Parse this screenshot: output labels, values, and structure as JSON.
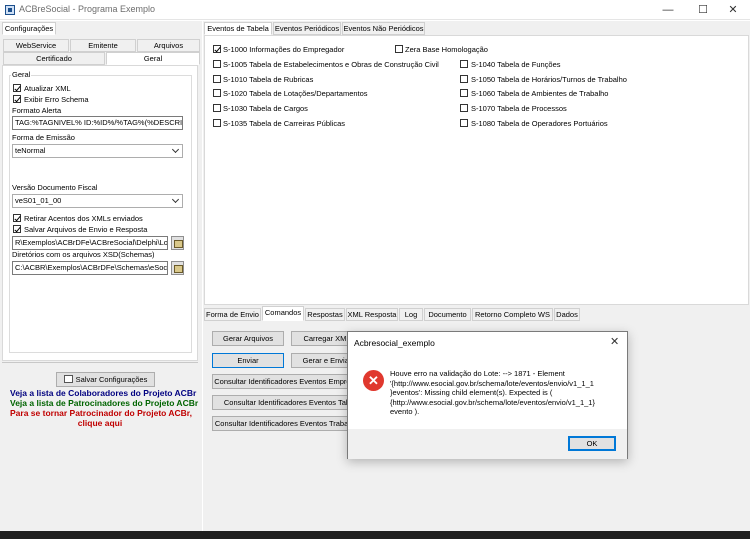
{
  "window": {
    "title": "ACBreSocial - Programa Exemplo",
    "minimize_glyph": "—",
    "maximize_glyph": "☐",
    "close_glyph": "✕"
  },
  "left": {
    "header": "Configurações",
    "tabs_row1": [
      "WebService",
      "Emitente",
      "Arquivos"
    ],
    "tabs_row2": [
      "Certificado",
      "Geral"
    ],
    "active_tab": "Geral",
    "group_title": "Geral",
    "chk_atualizar": "Atualizar XML",
    "chk_exibir": "Exibir Erro Schema",
    "lbl_formato": "Formato Alerta",
    "formato_value": "TAG:%TAGNIVEL% ID:%ID%/%TAG%(%DESCRI",
    "lbl_emissao": "Forma de Emissão",
    "emissao_value": "teNormal",
    "lbl_versao": "Versão Documento Fiscal",
    "versao_value": "veS01_01_00",
    "chk_retirar": "Retirar Acentos dos XMLs enviados",
    "chk_salvar": "Salvar Arquivos de Envio e Resposta",
    "logs_path": "R\\Exemplos\\ACBrDFe\\ACBreSocial\\Delphi\\Logs",
    "lbl_xsd": "Diretórios com os arquivos XSD(Schemas)",
    "xsd_path": "C:\\ACBR\\Exemplos\\ACBrDFe\\Schemas\\eSocial",
    "save_button": "Salvar Configurações",
    "link1": "Veja a lista de Colaboradores do Projeto ACBr",
    "link2": "Veja a lista de Patrocinadores do Projeto ACBr",
    "link3": "Para se tornar Patrocinador do Projeto ACBr,",
    "link4": "clique aqui"
  },
  "events": {
    "tabs": [
      "Eventos de Tabela",
      "Eventos Periódicos",
      "Eventos Não Periódicos"
    ],
    "col1": [
      "S-1000 Informações do Empregador",
      "S-1005 Tabela de Estabelecimentos e Obras de Construção Civil",
      "S-1010 Tabela de Rubricas",
      "S-1020 Tabela de Lotações/Departamentos",
      "S-1030 Tabela de Cargos",
      "S-1035 Tabela de Carreiras Públicas"
    ],
    "col2": [
      "Zera Base Homologação",
      "S-1040 Tabela de Funções",
      "S-1050 Tabela de Horários/Turnos de Trabalho",
      "S-1060 Tabela de Ambientes de Trabalho",
      "S-1070 Tabela de Processos",
      "S-1080 Tabela de Operadores Portuários"
    ]
  },
  "bottom": {
    "tabs": [
      "Forma de Envio",
      "Comandos",
      "Respostas",
      "XML Resposta",
      "Log",
      "Documento",
      "Retorno Completo WS",
      "Dados"
    ],
    "active_tab": "Comandos",
    "btn_gerar": "Gerar Arquivos",
    "btn_carregar": "Carregar XML",
    "btn_enviar": "Enviar",
    "btn_gerar_enviar": "Gerar e Enviar",
    "btn_consultar_emp": "Consultar Identificadores Eventos Empregador",
    "btn_consultar_tab": "Consultar Identificadores Eventos Tabela",
    "btn_consultar_trab": "Consultar Identificadores Eventos Trabalhador"
  },
  "dialog": {
    "title": "Acbresocial_exemplo",
    "message": "Houve erro na validação do Lote:  --> 1871 - Element\n'{http://www.esocial.gov.br/schema/lote/eventos/envio/v1_1_1\n}eventos': Missing child element(s). Expected is (\n{http://www.esocial.gov.br/schema/lote/eventos/envio/v1_1_1}\nevento ).",
    "ok": "OK",
    "close_glyph": "✕",
    "error_glyph": "✕"
  }
}
